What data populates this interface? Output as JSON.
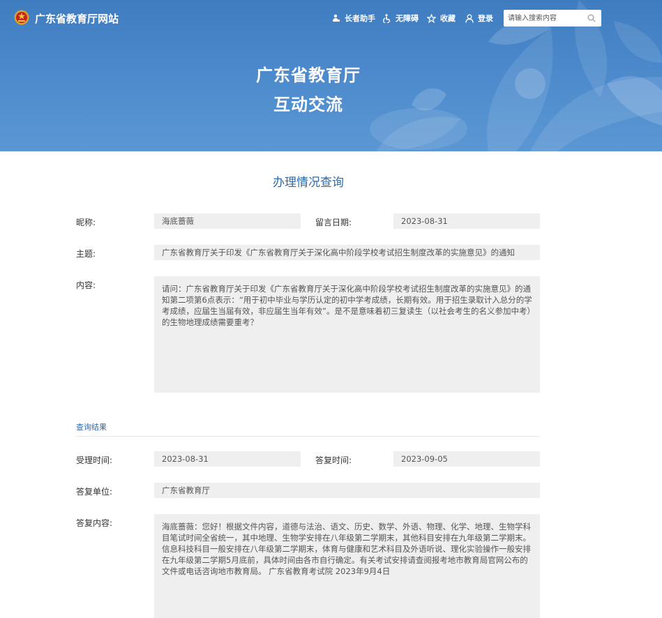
{
  "header": {
    "site_name": "广东省教育厅网站",
    "nav": [
      {
        "label": "长者助手",
        "icon": "elder-assist-icon"
      },
      {
        "label": "无障碍",
        "icon": "accessibility-icon"
      },
      {
        "label": "收藏",
        "icon": "star-icon"
      },
      {
        "label": "登录",
        "icon": "user-icon"
      }
    ],
    "search_placeholder": "请输入搜索内容"
  },
  "banner": {
    "title_line1": "广东省教育厅",
    "title_line2": "互动交流"
  },
  "query": {
    "section_title": "办理情况查询",
    "nickname_label": "昵称:",
    "nickname": "海底蔷薇",
    "date_label": "留言日期:",
    "date": "2023-08-31",
    "subject_label": "主题:",
    "subject": "广东省教育厅关于印发《广东省教育厅关于深化高中阶段学校考试招生制度改革的实施意见》的通知",
    "content_label": "内容:",
    "content": "请问：广东省教育厅关于印发《广东省教育厅关于深化高中阶段学校考试招生制度改革的实施意见》的通知第二项第6点表示：“用于初中毕业与学历认定的初中学考成绩，长期有效。用于招生录取计入总分的学考成绩，应届生当届有效，非应届生当年有效”。是不是意味着初三复读生（以社会考生的名义参加中考）的生物地理成绩需要重考？"
  },
  "result": {
    "heading": "查询结果",
    "accept_time_label": "受理时间:",
    "accept_time": "2023-08-31",
    "reply_time_label": "答复时间:",
    "reply_time": "2023-09-05",
    "reply_unit_label": "答复单位:",
    "reply_unit": "广东省教育厅",
    "reply_content_label": "答复内容:",
    "reply_content": "海底蔷薇：您好！根据文件内容，道德与法治、语文、历史、数学、外语、物理、化学、地理、生物学科目笔试时间全省统一，其中地理、生物学安排在八年级第二学期末，其他科目安排在九年级第二学期末。信息科技科目一般安排在八年级第二学期末，体育与健康和艺术科目及外语听说、理化实验操作一般安排在九年级第二学期5月底前，具体时间由各市自行确定。有关考试安排请查阅报考地市教育局官网公布的文件或电话咨询地市教育局。 广东省教育考试院 2023年9月4日"
  }
}
